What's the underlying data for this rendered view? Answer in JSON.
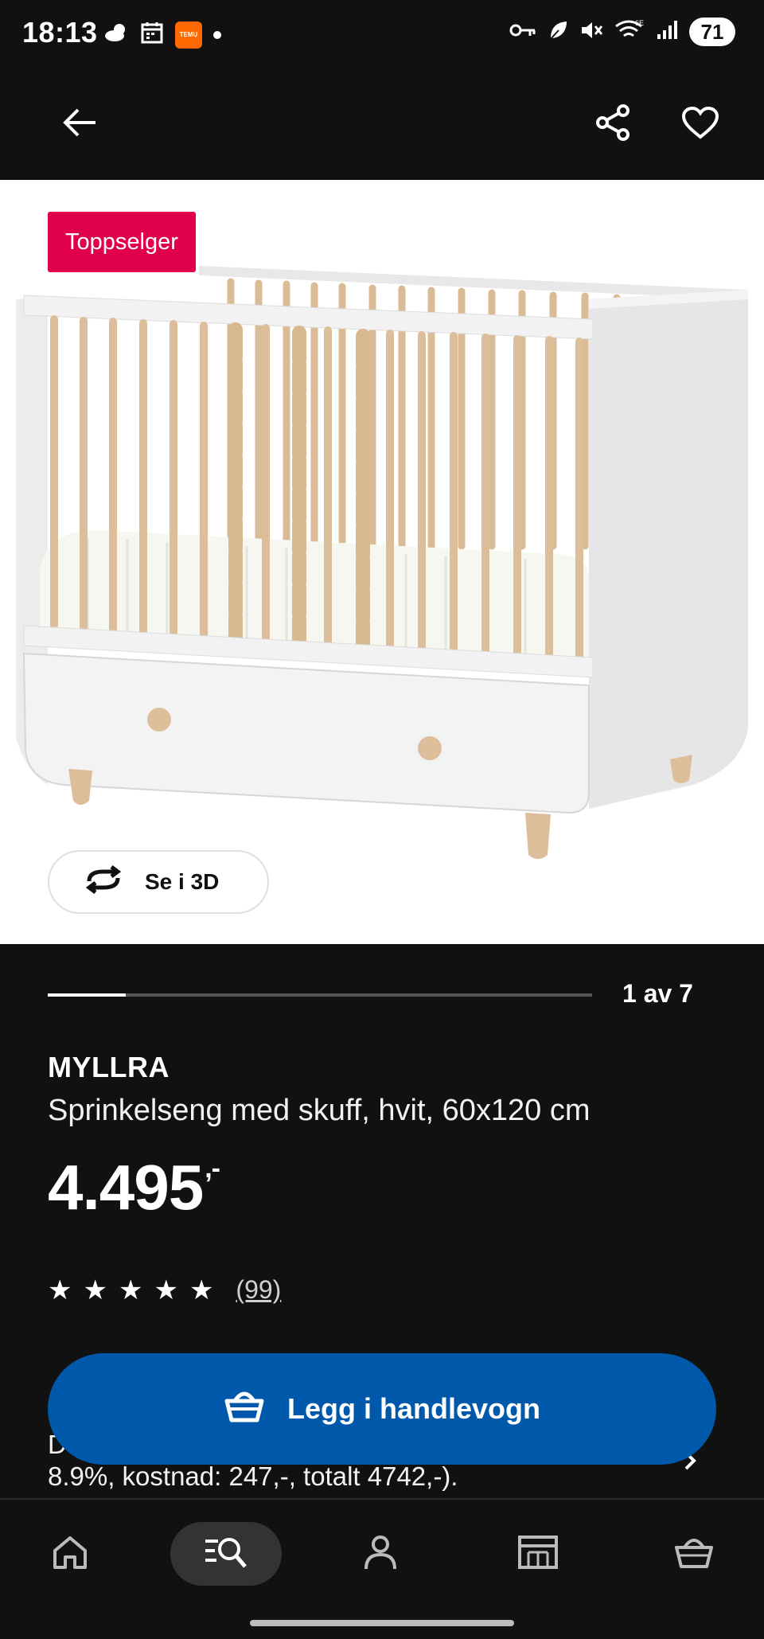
{
  "status_bar": {
    "time": "18:13",
    "temu_label": "TEMU",
    "battery": "71",
    "icons_left": [
      "weather-icon",
      "calendar-icon",
      "temu-app-icon",
      "notification-dot-icon"
    ],
    "icons_right": [
      "vpn-key-icon",
      "leaf-icon",
      "mute-icon",
      "wifi-6e-icon",
      "signal-icon",
      "battery-icon"
    ]
  },
  "header": {
    "back_icon": "arrow-left-icon",
    "share_icon": "share-icon",
    "favorite_icon": "heart-icon"
  },
  "product_image": {
    "badge": "Toppselger",
    "view_3d_label": "Se i 3D",
    "view_3d_icon": "rotate-3d-icon"
  },
  "gallery": {
    "position_label": "1 av 7",
    "current": 1,
    "total": 7
  },
  "product": {
    "brand": "MYLLRA",
    "description": "Sprinkelseng med skuff, hvit, 60x120 cm",
    "price": "4.495",
    "price_suffix": ",-",
    "rating": 5,
    "review_count": "(99)"
  },
  "financing": {
    "partial_text": "D",
    "text": "8.9%, kostnad: 247,-, totalt 4742,-)."
  },
  "cart_button": {
    "label": "Legg i handlevogn",
    "icon": "basket-icon"
  },
  "bottom_nav": {
    "items": [
      {
        "name": "home",
        "icon": "home-icon"
      },
      {
        "name": "search",
        "icon": "search-list-icon",
        "active": true
      },
      {
        "name": "profile",
        "icon": "person-icon"
      },
      {
        "name": "store",
        "icon": "store-icon"
      },
      {
        "name": "cart",
        "icon": "basket-icon"
      }
    ]
  },
  "colors": {
    "background": "#111111",
    "accent_blue": "#0058ab",
    "badge_red": "#e0004d",
    "wood": "#dcbf9a"
  }
}
